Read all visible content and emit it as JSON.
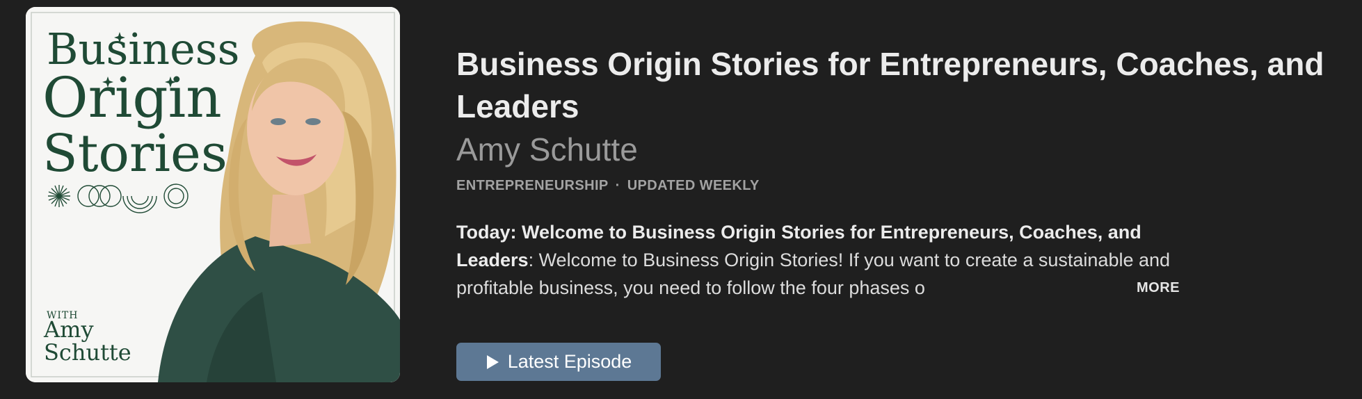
{
  "artwork": {
    "title_lines": [
      "Business",
      "Origin",
      "Stories"
    ],
    "with_label": "WITH",
    "host_lines": [
      "Amy",
      "Schutte"
    ],
    "accent_color": "#1f4a35"
  },
  "podcast": {
    "title": "Business Origin Stories for Entrepreneurs, Coaches, and Leaders",
    "author": "Amy Schutte",
    "category": "ENTREPRENEURSHIP",
    "separator": "·",
    "frequency": "UPDATED WEEKLY"
  },
  "description": {
    "lead": "Today: Welcome to Business Origin Stories for Entrepreneurs, Coaches, and Leaders",
    "body": ": Welcome to Business Origin Stories! If you want to create a sustainable and profitable business, you need to follow the four phases o",
    "more_label": "MORE"
  },
  "actions": {
    "play_label": "Latest Episode",
    "play_color": "#5d7894"
  }
}
